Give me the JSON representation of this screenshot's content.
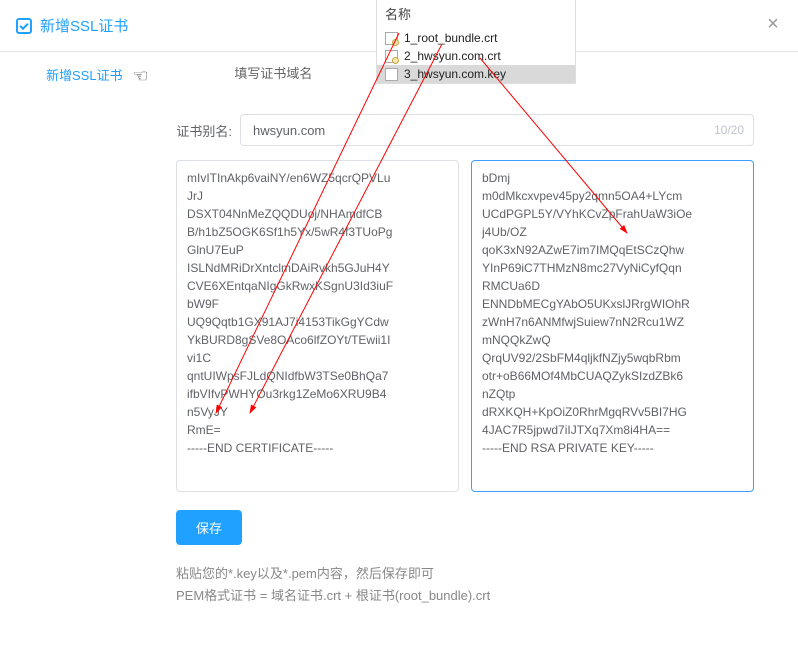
{
  "header": {
    "title": "新增SSL证书"
  },
  "tabs": {
    "add": "新增SSL证书",
    "fill": "填写证书域名"
  },
  "form": {
    "alias_label": "证书别名:",
    "alias_value": "hwsyun.com",
    "alias_counter": "10/20"
  },
  "cert": "mIvITInAkp6vaiNY/en6WZ5qcrQPVLu\nJrJ\nDSXT04NnMeZQQDUoj/NHAmdfCB\nB/h1bZ5OGK6Sf1h5Yx/5wR4f3TUoPg\nGlnU7EuP\nISLNdMRiDrXntclmDAiRvkh5GJuH4Y\nCVE6XEntqaNIgGkRwxKSgnU3Id3iuF\nbW9F\nUQ9Qqtb1GX91AJ7i4153TikGgYCdw\nYkBURD8gSVe8OAco6lfZOYt/TEwii1I\nvi1C\nqntUIWpsFJLdQNIdfbW3TSe0BhQa7\nifbVIfvPWHYOu3rkg1ZeMo6XRU9B4\nn5VyJY\nRmE=\n-----END CERTIFICATE-----",
  "key": "bDmj\nm0dMkcxvpev45py2qmn5OA4+LYcm\nUCdPGPL5Y/VYhKCvZpFrahUaW3iOe\nj4Ub/OZ\nqoK3xN92AZwE7im7IMQqEtSCzQhw\nYInP69iC7THMzN8mc27VyNiCyfQqn\nRMCUa6D\nENNDbMECgYAbO5UKxslJRrgWIOhR\nzWnH7n6ANMfwjSuiew7nN2Rcu1WZ\nmNQQkZwQ\nQrqUV92/2SbFM4qljkfNZjy5wqbRbm\notr+oB66MOf4MbCUAQZykSIzdZBk6\nnZQtp\ndRXKQH+KpOiZ0RhrMgqRVv5BI7HG\n4JAC7R5jpwd7iIJTXq7Xm8i4HA==\n-----END RSA PRIVATE KEY-----",
  "save_label": "保存",
  "hint1": "粘贴您的*.key以及*.pem内容，然后保存即可",
  "hint2": "PEM格式证书 = 域名证书.crt + 根证书(root_bundle).crt",
  "files": {
    "header": "名称",
    "items": [
      {
        "name": "1_root_bundle.crt",
        "kind": "crt"
      },
      {
        "name": "2_hwsyun.com.crt",
        "kind": "crt"
      },
      {
        "name": "3_hwsyun.com.key",
        "kind": "key",
        "selected": true
      }
    ]
  }
}
